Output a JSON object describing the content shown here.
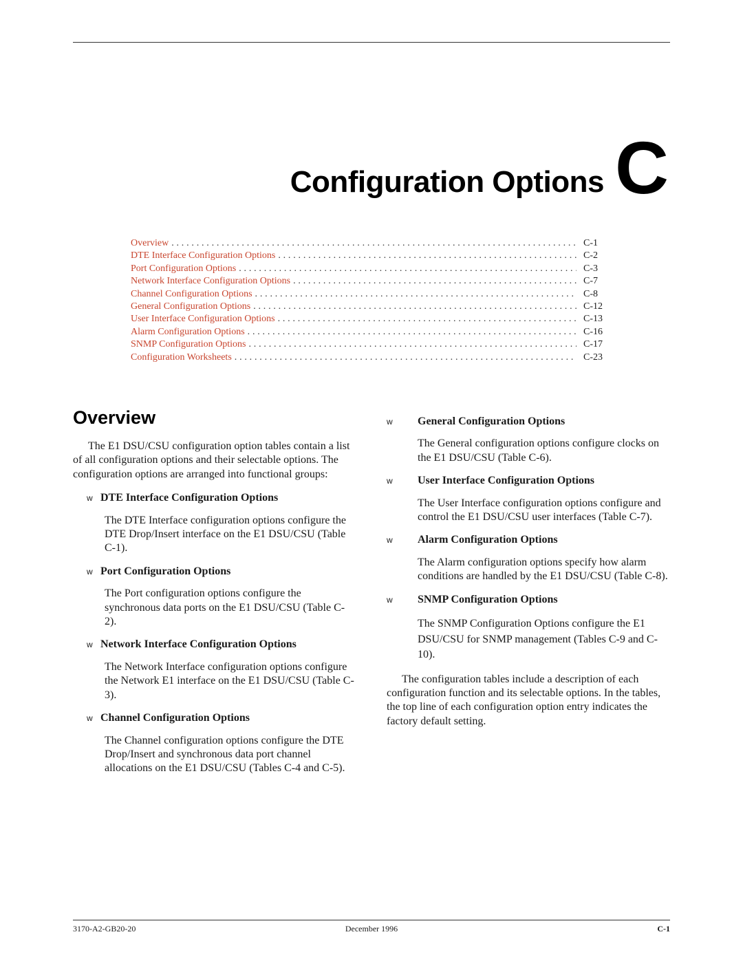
{
  "chapter": {
    "title": "Configuration Options",
    "letter": "C"
  },
  "toc": [
    {
      "label": "Overview",
      "page": "C-1"
    },
    {
      "label": "DTE Interface Configuration Options",
      "page": "C-2"
    },
    {
      "label": "Port Configuration Options",
      "page": "C-3"
    },
    {
      "label": "Network Interface Configuration Options",
      "page": "C-7"
    },
    {
      "label": "Channel Configuration Options",
      "page": "C-8"
    },
    {
      "label": "General Configuration Options",
      "page": "C-12"
    },
    {
      "label": "User Interface Configuration Options",
      "page": "C-13"
    },
    {
      "label": "Alarm Configuration Options",
      "page": "C-16"
    },
    {
      "label": "SNMP Configuration Options",
      "page": "C-17"
    },
    {
      "label": "Configuration Worksheets",
      "page": "C-23"
    }
  ],
  "overview": {
    "heading": "Overview",
    "intro": "The E1 DSU/CSU configuration option tables contain a list of all configuration options and their selectable options. The configuration options are arranged into functional groups:",
    "bullet_marker": "w",
    "groups": [
      {
        "title": "DTE Interface Configuration Options",
        "text": "The DTE Interface configuration options configure the DTE Drop/Insert interface on the E1 DSU/CSU (Table C-1)."
      },
      {
        "title": "Port Configuration Options",
        "text": "The Port configuration options configure the synchronous data ports on the E1 DSU/CSU (Table C-2)."
      },
      {
        "title": "Network Interface Configuration Options",
        "text": "The Network Interface configuration options configure the Network E1 interface on the E1 DSU/CSU (Table C-3)."
      },
      {
        "title": "Channel Configuration Options",
        "text": "The Channel configuration options configure the DTE Drop/Insert and synchronous data port channel allocations on the E1 DSU/CSU (Tables C-4 and C-5)."
      },
      {
        "title": "General Configuration Options",
        "text": "The General configuration options configure clocks on the E1 DSU/CSU (Table C-6)."
      },
      {
        "title": "User Interface Configuration Options",
        "text": "The User Interface configuration options configure and control the E1 DSU/CSU user interfaces (Table C-7)."
      },
      {
        "title": "Alarm Configuration Options",
        "text": "The Alarm configuration options specify how alarm conditions are handled by the E1 DSU/CSU (Table C-8)."
      },
      {
        "title": "SNMP Configuration Options",
        "text": "The SNMP Configuration Options configure the E1 DSU/CSU for SNMP management (Tables C-9 and C-10)."
      }
    ],
    "closing": "The configuration tables include a description of each configuration function and its selectable options. In the tables, the top line of each configuration option entry indicates the factory default setting."
  },
  "footer": {
    "doc_number": "3170-A2-GB20-20",
    "date": "December 1996",
    "page": "C-1"
  },
  "colors": {
    "toc_link": "#c8452e",
    "text": "#1a1a1a"
  }
}
